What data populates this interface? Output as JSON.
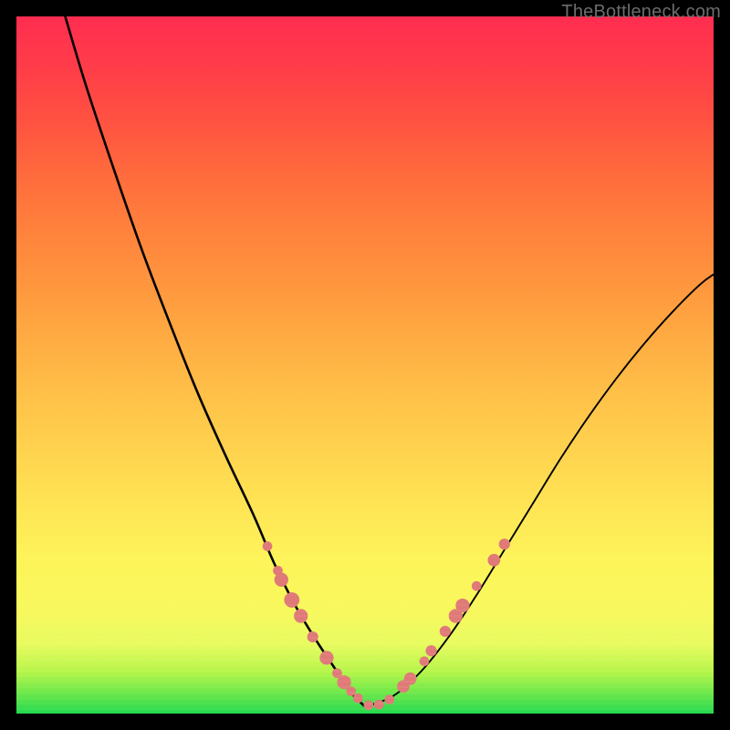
{
  "watermark": {
    "text": "TheBottleneck.com"
  },
  "colors": {
    "gradient_top": "#ff2d50",
    "gradient_bottom": "#25d94f",
    "curve": "#000000",
    "marker": "#e07a78",
    "frame_bg": "#000000"
  },
  "chart_data": {
    "type": "line",
    "title": "",
    "xlabel": "",
    "ylabel": "",
    "xlim": [
      0,
      100
    ],
    "ylim": [
      0,
      100
    ],
    "grid": false,
    "series": [
      {
        "name": "left-curve",
        "x": [
          7,
          10,
          14,
          18,
          22,
          26,
          30,
          34,
          37,
          40,
          43,
          46,
          48,
          50
        ],
        "values": [
          100,
          90,
          78,
          66.5,
          56,
          46,
          37,
          28.5,
          21.5,
          15.5,
          10.5,
          6,
          3,
          1
        ]
      },
      {
        "name": "right-curve",
        "x": [
          50,
          54,
          58,
          62,
          66,
          70,
          74,
          78,
          82,
          86,
          90,
          94,
          98,
          100
        ],
        "values": [
          1,
          2.5,
          6,
          11,
          17,
          23.5,
          30,
          36.5,
          42.5,
          48,
          53,
          57.5,
          61.5,
          63
        ]
      }
    ],
    "markers": {
      "name": "data-points",
      "r_small": 0.6,
      "r_large": 1.1,
      "points": [
        {
          "x": 36.0,
          "y": 24.0,
          "r": 0.7
        },
        {
          "x": 37.5,
          "y": 20.5,
          "r": 0.7
        },
        {
          "x": 38.0,
          "y": 19.2,
          "r": 1.0
        },
        {
          "x": 39.5,
          "y": 16.3,
          "r": 1.1
        },
        {
          "x": 40.8,
          "y": 14.0,
          "r": 1.0
        },
        {
          "x": 42.5,
          "y": 11.0,
          "r": 0.8
        },
        {
          "x": 44.5,
          "y": 8.0,
          "r": 1.0
        },
        {
          "x": 46.0,
          "y": 5.8,
          "r": 0.7
        },
        {
          "x": 47.0,
          "y": 4.5,
          "r": 1.0
        },
        {
          "x": 48.0,
          "y": 3.2,
          "r": 0.7
        },
        {
          "x": 49.0,
          "y": 2.2,
          "r": 0.7
        },
        {
          "x": 50.5,
          "y": 1.2,
          "r": 0.7
        },
        {
          "x": 52.0,
          "y": 1.3,
          "r": 0.7
        },
        {
          "x": 53.5,
          "y": 2.0,
          "r": 0.7
        },
        {
          "x": 55.5,
          "y": 3.9,
          "r": 0.9
        },
        {
          "x": 56.5,
          "y": 5.0,
          "r": 0.9
        },
        {
          "x": 58.5,
          "y": 7.5,
          "r": 0.7
        },
        {
          "x": 59.5,
          "y": 9.0,
          "r": 0.8
        },
        {
          "x": 61.5,
          "y": 11.8,
          "r": 0.8
        },
        {
          "x": 63.0,
          "y": 14.0,
          "r": 1.0
        },
        {
          "x": 64.0,
          "y": 15.5,
          "r": 1.0
        },
        {
          "x": 66.0,
          "y": 18.3,
          "r": 0.7
        },
        {
          "x": 68.5,
          "y": 22.0,
          "r": 0.9
        },
        {
          "x": 70.0,
          "y": 24.3,
          "r": 0.8
        }
      ]
    }
  }
}
